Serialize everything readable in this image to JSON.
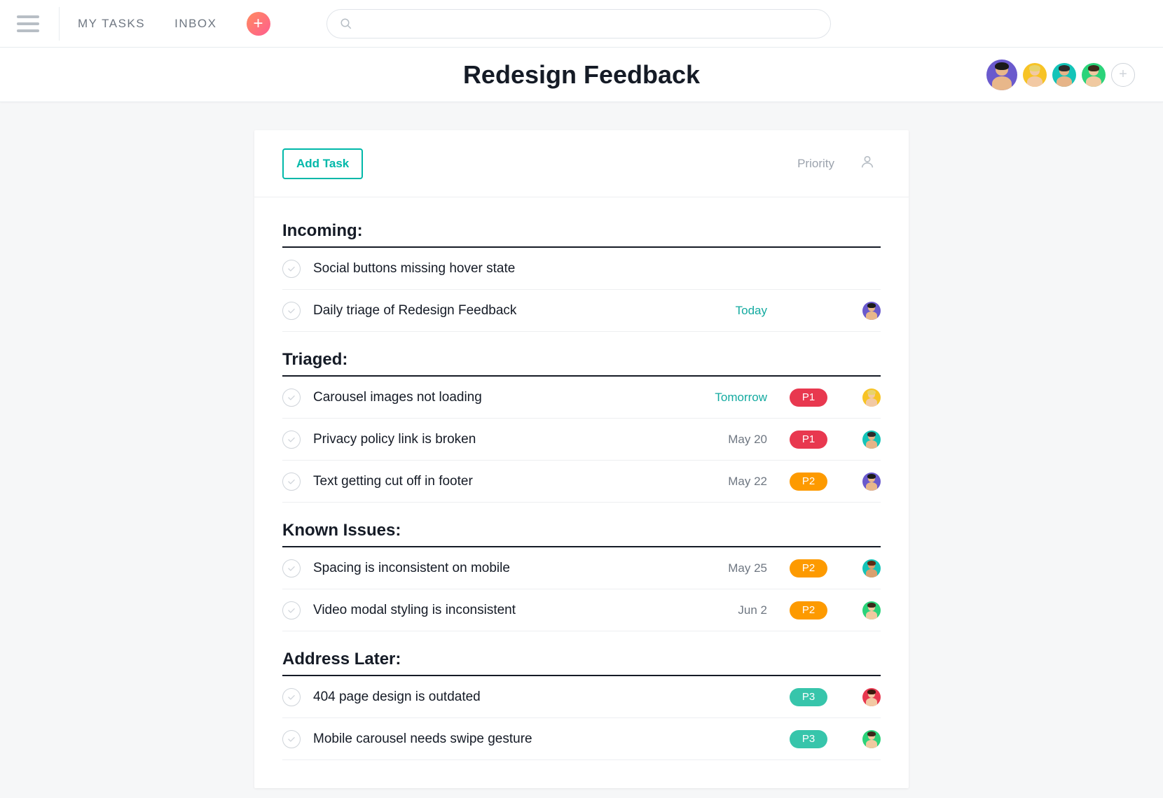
{
  "nav": {
    "my_tasks": "MY TASKS",
    "inbox": "INBOX"
  },
  "search": {
    "placeholder": ""
  },
  "project": {
    "title": "Redesign Feedback"
  },
  "members": [
    {
      "bg": "#6a5acd",
      "skin": "#e8b78a",
      "hair": "#1a1a1a"
    },
    {
      "bg": "#f7c325",
      "skin": "#f2c9a4",
      "hair": "#e8d36b"
    },
    {
      "bg": "#14c4b8",
      "skin": "#e6b488",
      "hair": "#2b2b2b"
    },
    {
      "bg": "#2bd37a",
      "skin": "#f0c9a0",
      "hair": "#3a2a1a"
    }
  ],
  "toolbar": {
    "add_task": "Add Task",
    "priority": "Priority"
  },
  "priority_colors": {
    "P1": "#e8384f",
    "P2": "#fd9a00",
    "P3": "#37c5ab"
  },
  "sections": [
    {
      "title": "Incoming:",
      "tasks": [
        {
          "title": "Social buttons missing hover state",
          "due": "",
          "due_accent": false,
          "priority": "",
          "assignee": null
        },
        {
          "title": "Daily triage of Redesign Feedback",
          "due": "Today",
          "due_accent": true,
          "priority": "",
          "assignee": {
            "bg": "#6a5acd",
            "skin": "#e8b78a",
            "hair": "#1a1a1a"
          }
        }
      ]
    },
    {
      "title": "Triaged:",
      "tasks": [
        {
          "title": "Carousel images not loading",
          "due": "Tomorrow",
          "due_accent": true,
          "priority": "P1",
          "assignee": {
            "bg": "#f7c325",
            "skin": "#f2c9a4",
            "hair": "#e8d36b"
          }
        },
        {
          "title": "Privacy policy link is broken",
          "due": "May 20",
          "due_accent": false,
          "priority": "P1",
          "assignee": {
            "bg": "#14c4b8",
            "skin": "#e6b488",
            "hair": "#2b2b2b"
          }
        },
        {
          "title": "Text getting cut off in footer",
          "due": "May 22",
          "due_accent": false,
          "priority": "P2",
          "assignee": {
            "bg": "#6a5acd",
            "skin": "#e8b78a",
            "hair": "#1a1a1a"
          }
        }
      ]
    },
    {
      "title": "Known Issues:",
      "tasks": [
        {
          "title": "Spacing is inconsistent on mobile",
          "due": "May 25",
          "due_accent": false,
          "priority": "P2",
          "assignee": {
            "bg": "#14c4b8",
            "skin": "#d9a06f",
            "hair": "#5a2d16"
          }
        },
        {
          "title": "Video modal styling is inconsistent",
          "due": "Jun 2",
          "due_accent": false,
          "priority": "P2",
          "assignee": {
            "bg": "#2bd37a",
            "skin": "#f0c9a0",
            "hair": "#3a2a1a"
          }
        }
      ]
    },
    {
      "title": "Address Later:",
      "tasks": [
        {
          "title": "404 page design is outdated",
          "due": "",
          "due_accent": false,
          "priority": "P3",
          "assignee": {
            "bg": "#e8384f",
            "skin": "#f2c9a4",
            "hair": "#3a1a0d"
          }
        },
        {
          "title": "Mobile carousel needs swipe gesture",
          "due": "",
          "due_accent": false,
          "priority": "P3",
          "assignee": {
            "bg": "#2bd37a",
            "skin": "#f0c9a0",
            "hair": "#3a2a1a"
          }
        }
      ]
    }
  ]
}
